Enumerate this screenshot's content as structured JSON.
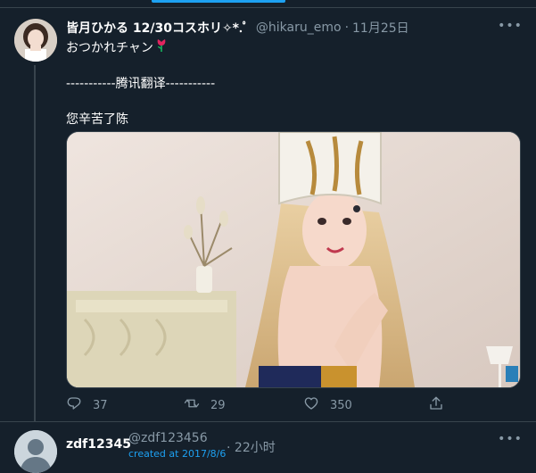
{
  "colors": {
    "background": "#15202b",
    "divider": "#38444d",
    "muted": "#8899a6",
    "accent": "#1da1f2",
    "text": "#ffffff"
  },
  "tweet1": {
    "display_name": "皆月ひかる 12/30コスホリ✧*.ﾟ",
    "handle": "@hikaru_emo",
    "separator": "·",
    "time": "11月25日",
    "more_icon": "more-dots-icon",
    "lines": [
      "おつかれチャン",
      "",
      "-----------腾讯翻译-----------",
      "",
      "您辛苦了陈"
    ],
    "emoji_icon": "tulip-emoji-icon",
    "actions": {
      "reply_count": "37",
      "retweet_count": "29",
      "like_count": "350"
    }
  },
  "tweet2": {
    "display_name": "zdf12345",
    "handle": "@zdf123456",
    "created": "created at 2017/8/6",
    "separator": "·",
    "time": "22小时",
    "more_icon": "more-dots-icon"
  }
}
